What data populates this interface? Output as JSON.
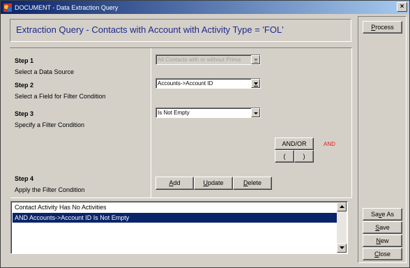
{
  "window": {
    "title": "DOCUMENT - Data Extraction Query",
    "close_label": "×"
  },
  "header": {
    "title": "Extraction Query - Contacts with Account with Activity Type = 'FOL'"
  },
  "steps": [
    {
      "title": "Step 1",
      "desc": "Select a Data Source"
    },
    {
      "title": "Step 2",
      "desc": "Select a Field for Filter Condition"
    },
    {
      "title": "Step 3",
      "desc": "Specify a Filter Condition"
    },
    {
      "title": "Step 4",
      "desc": "Apply the Filter Condition"
    }
  ],
  "data_source": {
    "value": "All Contacts with or without Prima",
    "enabled": false
  },
  "filter_field": {
    "value": "Accounts->Account ID"
  },
  "filter_condition": {
    "value": "Is Not Empty"
  },
  "logic": {
    "andor_label": "AND/OR",
    "open_paren": "(",
    "close_paren": ")",
    "current": "AND"
  },
  "actions": {
    "add": {
      "pre": "",
      "u": "A",
      "post": "dd"
    },
    "update": {
      "pre": "",
      "u": "U",
      "post": "pdate"
    },
    "delete": {
      "pre": "",
      "u": "D",
      "post": "elete"
    }
  },
  "conditions": [
    {
      "text": "Contact Activity Has No Activities",
      "selected": false
    },
    {
      "text": "AND Accounts->Account ID Is Not Empty",
      "selected": true
    }
  ],
  "sidebar": {
    "process": {
      "pre": "",
      "u": "P",
      "post": "rocess"
    },
    "save_as": {
      "pre": "Sa",
      "u": "v",
      "post": "e As"
    },
    "save": {
      "pre": "",
      "u": "S",
      "post": "ave"
    },
    "new": {
      "pre": "",
      "u": "N",
      "post": "ew"
    },
    "close": {
      "pre": "",
      "u": "C",
      "post": "lose"
    }
  },
  "colors": {
    "title_gradient_start": "#0a246a",
    "header_text": "#1c2a8c",
    "and_indicator": "#e02020",
    "selection": "#0a246a"
  }
}
